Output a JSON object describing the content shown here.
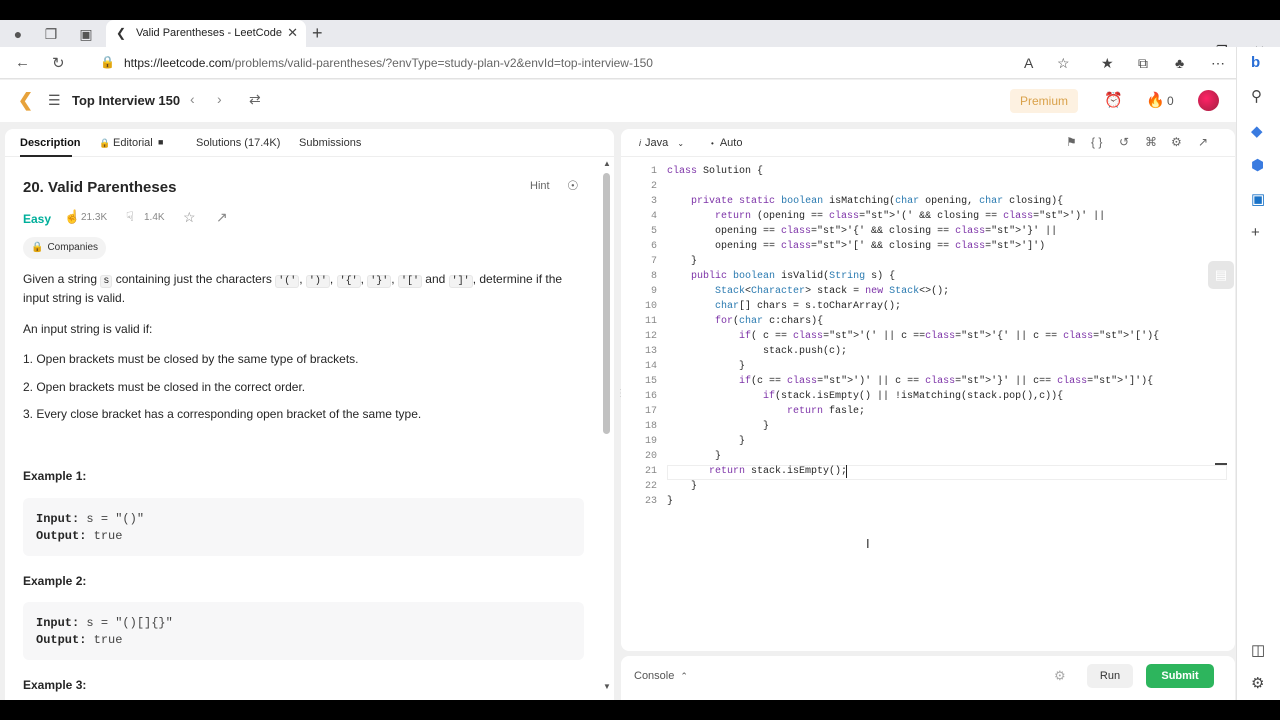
{
  "browser": {
    "tab_title": "Valid Parentheses - LeetCode",
    "url_host": "https://leetcode.com",
    "url_path": "/problems/valid-parentheses/?envType=study-plan-v2&envId=top-interview-150"
  },
  "header": {
    "list_title": "Top Interview 150",
    "premium_label": "Premium",
    "streak_count": "0"
  },
  "left_tabs": {
    "description": "Description",
    "editorial": "Editorial",
    "solutions": "Solutions (17.4K)",
    "submissions": "Submissions"
  },
  "problem": {
    "title": "20. Valid Parentheses",
    "hint": "Hint",
    "difficulty": "Easy",
    "likes": "21.3K",
    "dislikes": "1.4K",
    "companies": "Companies",
    "intro_a": "Given a string",
    "intro_s": "s",
    "intro_b": "containing just the characters",
    "c1": "'('",
    "c2": "')'",
    "c3": "'{'",
    "c4": "'}'",
    "c5": "'['",
    "c_and": "and",
    "c6": "']'",
    "intro_c": ", determine if the input string is valid.",
    "valid_if": "An input string is valid if:",
    "rule1": "1. Open brackets must be closed by the same type of brackets.",
    "rule2": "2. Open brackets must be closed in the correct order.",
    "rule3": "3. Every close bracket has a corresponding open bracket of the same type.",
    "example1_title": "Example 1:",
    "example1_input_label": "Input:",
    "example1_input": "s = \"()\"",
    "example1_output_label": "Output:",
    "example1_output": "true",
    "example2_title": "Example 2:",
    "example2_input_label": "Input:",
    "example2_input": "s = \"()[]{}\"",
    "example2_output_label": "Output:",
    "example2_output": "true",
    "example3_title": "Example 3:"
  },
  "editor": {
    "language": "Java",
    "mode": "Auto",
    "line_numbers": [
      "1",
      "2",
      "3",
      "4",
      "5",
      "6",
      "7",
      "8",
      "9",
      "10",
      "11",
      "12",
      "13",
      "14",
      "15",
      "16",
      "17",
      "18",
      "19",
      "20",
      "21",
      "22",
      "23"
    ],
    "lines": [
      "class Solution {",
      "",
      "    private static boolean isMatching(char opening, char closing){",
      "        return (opening == '(' && closing == ')' ||",
      "        opening == '{' && closing == '}' ||",
      "        opening == '[' && closing == ']')",
      "    }",
      "    public boolean isValid(String s) {",
      "        Stack<Character> stack = new Stack<>();",
      "        char[] chars = s.toCharArray();",
      "        for(char c:chars){",
      "            if( c == '(' || c =='{' || c == '['){",
      "                stack.push(c);",
      "            }",
      "            if(c == ')' || c == '}' || c== ']'){",
      "                if(stack.isEmpty() || !isMatching(stack.pop(),c)){",
      "                    return fasle;",
      "                }",
      "            }",
      "        }",
      "       return stack.isEmpty();",
      "    }",
      "}"
    ]
  },
  "console": {
    "label": "Console",
    "run": "Run",
    "submit": "Submit"
  }
}
